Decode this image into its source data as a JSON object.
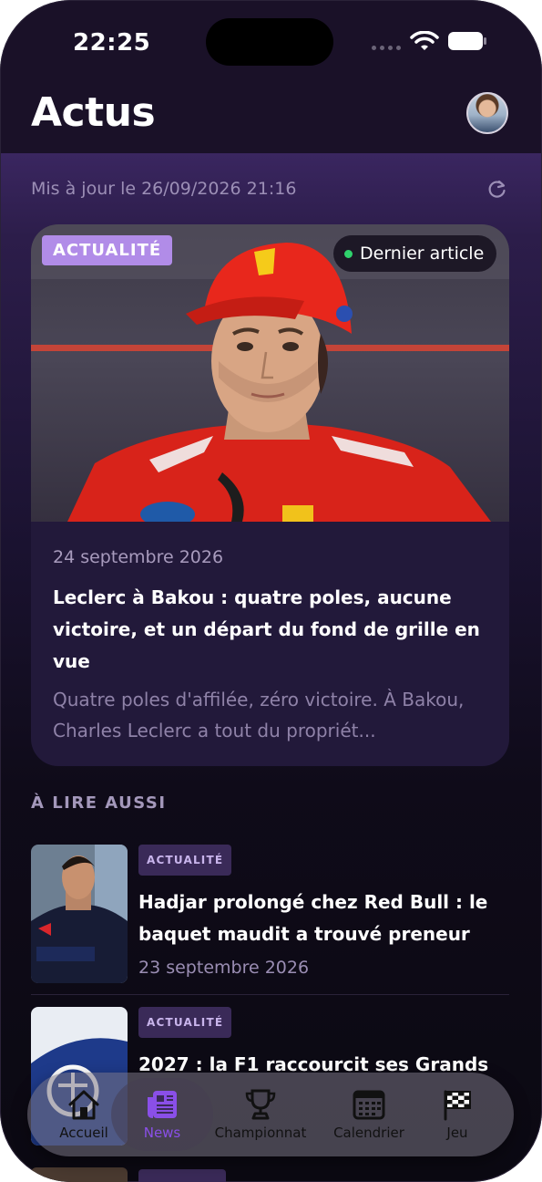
{
  "status_bar": {
    "time": "22:25"
  },
  "header": {
    "title": "Actus"
  },
  "update": {
    "text": "Mis à jour le 26/09/2026 21:16"
  },
  "featured": {
    "tag": "ACTUALITÉ",
    "badge": "Dernier article",
    "date": "24 septembre 2026",
    "title": "Leclerc à Bakou : quatre poles, aucune victoire, et un départ du fond de grille en vue",
    "excerpt": "Quatre poles d'affilée, zéro victoire. À Bakou, Charles Leclerc a tout du propriét..."
  },
  "section": {
    "title": "À LIRE AUSSI"
  },
  "articles": [
    {
      "tag": "ACTUALITÉ",
      "title": "Hadjar prolongé chez Red Bull : le baquet maudit a trouvé preneur p...",
      "date": "23 septembre 2026"
    },
    {
      "tag": "ACTUALITÉ",
      "title": "2027 : la F1 raccourcit ses Grands",
      "date": ""
    }
  ],
  "tabs": [
    {
      "label": "Accueil",
      "icon": "home-icon"
    },
    {
      "label": "News",
      "icon": "news-icon",
      "active": true
    },
    {
      "label": "Championnat",
      "icon": "trophy-icon"
    },
    {
      "label": "Calendrier",
      "icon": "calendar-icon"
    },
    {
      "label": "Jeu",
      "icon": "checkered-flag-icon"
    }
  ],
  "colors": {
    "accent": "#8a4fe8",
    "tag": "#b18ce8",
    "live": "#2fd16c"
  }
}
